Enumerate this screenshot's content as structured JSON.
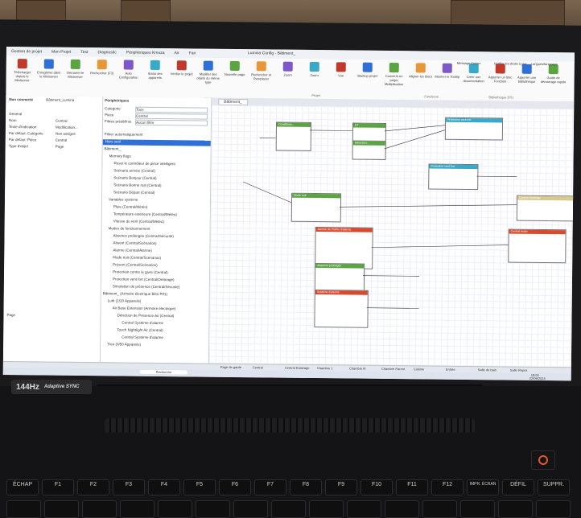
{
  "colors": {
    "accent": "#2f6fd6",
    "green": "#5aa542",
    "red": "#d9492e",
    "orange": "#e8963a",
    "cyan": "#39a9c9",
    "tan": "#d8c98f"
  },
  "window": {
    "title": "Lumina Config - Bâtiment_"
  },
  "menu": [
    "Gestion de projet",
    "Mon Projet",
    "Test",
    "Diagnostic",
    "Périphériques Kmoza",
    "Air",
    "Fan"
  ],
  "ribbon": {
    "buttons": [
      {
        "label": "Télécharger depuis le Miniserver",
        "icon": "download-icon"
      },
      {
        "label": "Enregistrer dans le Miniserver",
        "icon": "save-icon"
      },
      {
        "label": "Démarrer le Miniserver",
        "icon": "play-icon"
      },
      {
        "label": "Rechercher (F3)",
        "icon": "search-icon"
      },
      {
        "label": "Auto Configuration",
        "icon": "gear-icon"
      },
      {
        "label": "Statut des appareils",
        "icon": "status-icon"
      },
      {
        "label": "Vérifier le projet",
        "icon": "check-icon"
      },
      {
        "label": "Modifier des objets du même type",
        "icon": "gear-icon"
      },
      {
        "label": "Nouvelle page",
        "icon": "page-icon"
      },
      {
        "label": "Rechercher et Remplacer",
        "icon": "replace-icon"
      },
      {
        "label": "Zoom",
        "icon": "zoom-icon"
      },
      {
        "label": "Zoom",
        "icon": "zoom-icon"
      },
      {
        "label": "Vue",
        "icon": "view-icon"
      },
      {
        "label": "Backup projet",
        "icon": "backup-icon"
      },
      {
        "label": "Convertir en projet Multiplication",
        "icon": "convert-icon"
      },
      {
        "label": "Aligner les blocs",
        "icon": "align-icon"
      },
      {
        "label": "Montrer le Tooltip",
        "icon": "tooltip-icon"
      },
      {
        "label": "Créer une documentation",
        "icon": "doc-icon"
      },
      {
        "label": "Apporter un bloc Fonction",
        "icon": "import-icon"
      },
      {
        "label": "Apporter une bibliothèque",
        "icon": "library-icon"
      },
      {
        "label": "Guide de démarrage rapide",
        "icon": "guide-icon"
      }
    ],
    "right_links": [
      "Message Center",
      "Vérifier les droits à jour",
      "Langues/language"
    ],
    "groups": [
      "Projet",
      "Fonctions",
      "Bibliothèque (F5)"
    ]
  },
  "left_pane": {
    "status": "Non connecté",
    "project": "Bâtiment_Lumina",
    "props": [
      {
        "k": "Général",
        "v": ""
      },
      {
        "k": "Nom",
        "v": "Central"
      },
      {
        "k": "Texte d'indication",
        "v": "Modification..."
      },
      {
        "k": "Par défaut: Catégorie",
        "v": "Non assigné"
      },
      {
        "k": "Par défaut: Pièce",
        "v": "Central"
      },
      {
        "k": "Type d'objet",
        "v": "Page"
      }
    ],
    "page_label": "Page"
  },
  "tree": {
    "header": "Périphériques",
    "filters": [
      {
        "k": "Catégorie",
        "v": "Tous"
      },
      {
        "k": "Pièce",
        "v": "Central"
      },
      {
        "k": "Filtres prédéfinis",
        "v": "Aucun filtre"
      }
    ],
    "autofilter": "Filtrer automatiquement",
    "selected": "Hors outil",
    "rows": [
      "Bâtiment_",
      "Memory flags",
      "Reset le contrôleur de pièce intelligent",
      "Scénario arrivée (Central)",
      "Scénario Bonjour (Central)",
      "Scénario Bonne nuit (Central)",
      "Scénario Départ (Central)",
      "Variables système",
      "Pluie (Central/Météo)",
      "Température extérieure (Central/Météo)",
      "Vitesse du vent (Central/Météo)",
      "Modes de fonctionnement",
      "Absence prolongée (Central/Sécurité)",
      "Absent (Central/Scénarios)",
      "Alarme (Central/Alarme)",
      "Mode nuit (Central/Scénarios)",
      "Présent (Central/Scénarios)",
      "Protection contre le givre (Central)",
      "Protection vent fort (Central/Ombrage)",
      "Simulation de présence (Central/Sécurité)",
      "Bâtiment_ (Armoire électrique BD1 P01)",
      "Lurk (1/20 Appareils)",
      "Air Base Extension (Armoire électrique)",
      "Détection de Présence Air (Central)",
      "Central Système d'alarme",
      "Touch Nightlight Air (Central)",
      "Central Système d'alarme",
      "Tree (0/50 Appareils)"
    ]
  },
  "doc_tab": "Bâtiment_",
  "blocks": [
    {
      "title": "Conditions...",
      "color": "green"
    },
    {
      "title": "ET",
      "color": "green"
    },
    {
      "title": "Détection...",
      "color": "green"
    },
    {
      "title": "Protection vent fort",
      "color": "cyan"
    },
    {
      "title": "Protection vent fort",
      "color": "cyan"
    },
    {
      "title": "Central Ombrage",
      "color": "tan"
    },
    {
      "title": "Central Audio",
      "color": "red"
    },
    {
      "title": "Mode nuit",
      "color": "green"
    },
    {
      "title": "Alarme de chaîne d'alarme",
      "color": "red"
    },
    {
      "title": "Absence prolongée",
      "color": "green"
    },
    {
      "title": "Système d'alarme",
      "color": "red"
    }
  ],
  "bottom_tabs": [
    "Page de garde",
    "Central",
    "Central Eclairage",
    "Chambre 1",
    "Chambre lit",
    "Chambre Parent",
    "Cuisine",
    "Entrée",
    "Salle de bain",
    "Salle Repos"
  ],
  "status_bar": {
    "left": "Recherche",
    "time": "18:00",
    "date": "22/09/2024"
  },
  "keyboard": {
    "badge_refresh": "144Hz",
    "badge_sync": "Adaptive SYNC",
    "keys": [
      "ÉCHAP",
      "F1",
      "F2",
      "F3",
      "F4",
      "F5",
      "F6",
      "F7",
      "F8",
      "F9",
      "F10",
      "F11",
      "F12",
      "IMPR. ÉCRAN",
      "DÉFIL",
      "SUPPR."
    ]
  }
}
